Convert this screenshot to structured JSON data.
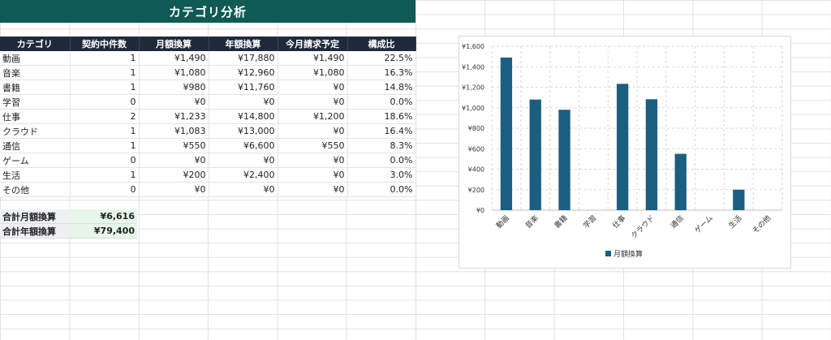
{
  "sheet": {
    "title": "カテゴリ分析",
    "headers": [
      "カテゴリ",
      "契約中件数",
      "月額換算",
      "年額換算",
      "今月請求予定",
      "構成比"
    ],
    "rows": [
      {
        "category": "動画",
        "count": "1",
        "monthly": "¥1,490",
        "yearly": "¥17,880",
        "billing": "¥1,490",
        "share": "22.5%"
      },
      {
        "category": "音楽",
        "count": "1",
        "monthly": "¥1,080",
        "yearly": "¥12,960",
        "billing": "¥1,080",
        "share": "16.3%"
      },
      {
        "category": "書籍",
        "count": "1",
        "monthly": "¥980",
        "yearly": "¥11,760",
        "billing": "¥0",
        "share": "14.8%"
      },
      {
        "category": "学習",
        "count": "0",
        "monthly": "¥0",
        "yearly": "¥0",
        "billing": "¥0",
        "share": "0.0%"
      },
      {
        "category": "仕事",
        "count": "2",
        "monthly": "¥1,233",
        "yearly": "¥14,800",
        "billing": "¥1,200",
        "share": "18.6%"
      },
      {
        "category": "クラウド",
        "count": "1",
        "monthly": "¥1,083",
        "yearly": "¥13,000",
        "billing": "¥0",
        "share": "16.4%"
      },
      {
        "category": "通信",
        "count": "1",
        "monthly": "¥550",
        "yearly": "¥6,600",
        "billing": "¥550",
        "share": "8.3%"
      },
      {
        "category": "ゲーム",
        "count": "0",
        "monthly": "¥0",
        "yearly": "¥0",
        "billing": "¥0",
        "share": "0.0%"
      },
      {
        "category": "生活",
        "count": "1",
        "monthly": "¥200",
        "yearly": "¥2,400",
        "billing": "¥0",
        "share": "3.0%"
      },
      {
        "category": "その他",
        "count": "0",
        "monthly": "¥0",
        "yearly": "¥0",
        "billing": "¥0",
        "share": "0.0%"
      }
    ],
    "totals": {
      "monthly_label": "合計月額換算",
      "monthly_value": "¥6,616",
      "yearly_label": "合計年額換算",
      "yearly_value": "¥79,400"
    }
  },
  "chart_data": {
    "type": "bar",
    "categories": [
      "動画",
      "音楽",
      "書籍",
      "学習",
      "仕事",
      "クラウド",
      "通信",
      "ゲーム",
      "生活",
      "その他"
    ],
    "series": [
      {
        "name": "月額換算",
        "values": [
          1490,
          1080,
          980,
          0,
          1233,
          1083,
          550,
          0,
          200,
          0
        ],
        "color": "#1b5e80"
      }
    ],
    "ylim": [
      0,
      1600
    ],
    "yticks": [
      "¥0",
      "¥200",
      "¥400",
      "¥600",
      "¥800",
      "¥1,000",
      "¥1,200",
      "¥1,400",
      "¥1,600"
    ],
    "grid": true,
    "legend_position": "bottom"
  }
}
